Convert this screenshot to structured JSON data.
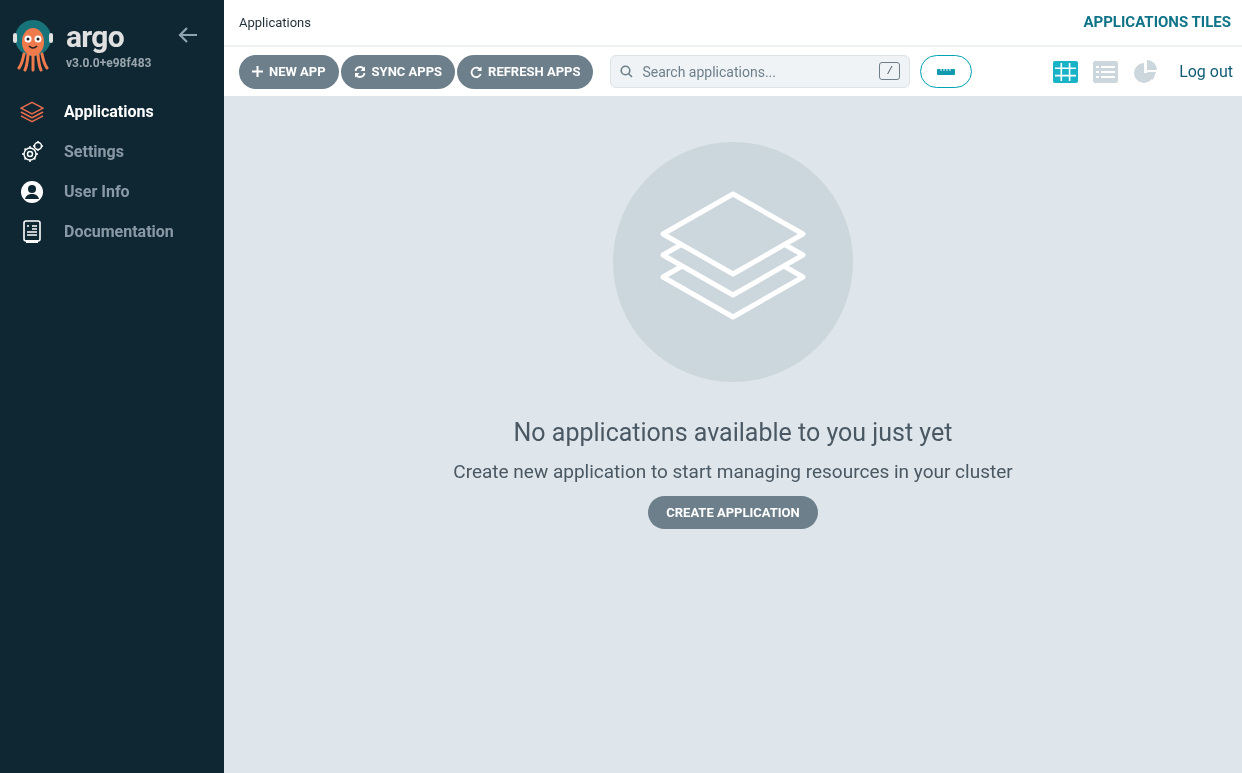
{
  "sidebar": {
    "logo_text": "argo",
    "version": "v3.0.0+e98f483",
    "items": [
      {
        "label": "Applications",
        "selected": true
      },
      {
        "label": "Settings",
        "selected": false
      },
      {
        "label": "User Info",
        "selected": false
      },
      {
        "label": "Documentation",
        "selected": false
      }
    ]
  },
  "top_bar": {
    "breadcrumb": "Applications",
    "title": "APPLICATIONS TILES"
  },
  "toolbar": {
    "buttons": [
      {
        "label": "NEW APP"
      },
      {
        "label": "SYNC APPS"
      },
      {
        "label": "REFRESH APPS"
      }
    ],
    "search": {
      "placeholder": "Search applications...",
      "shortcut": "/"
    },
    "views": [
      {
        "selected": true
      },
      {
        "selected": false
      },
      {
        "selected": false
      }
    ],
    "logout": "Log out"
  },
  "empty_state": {
    "heading": "No applications available to you just yet",
    "message": "Create new application to start managing resources in your cluster",
    "button": "CREATE APPLICATION"
  }
}
